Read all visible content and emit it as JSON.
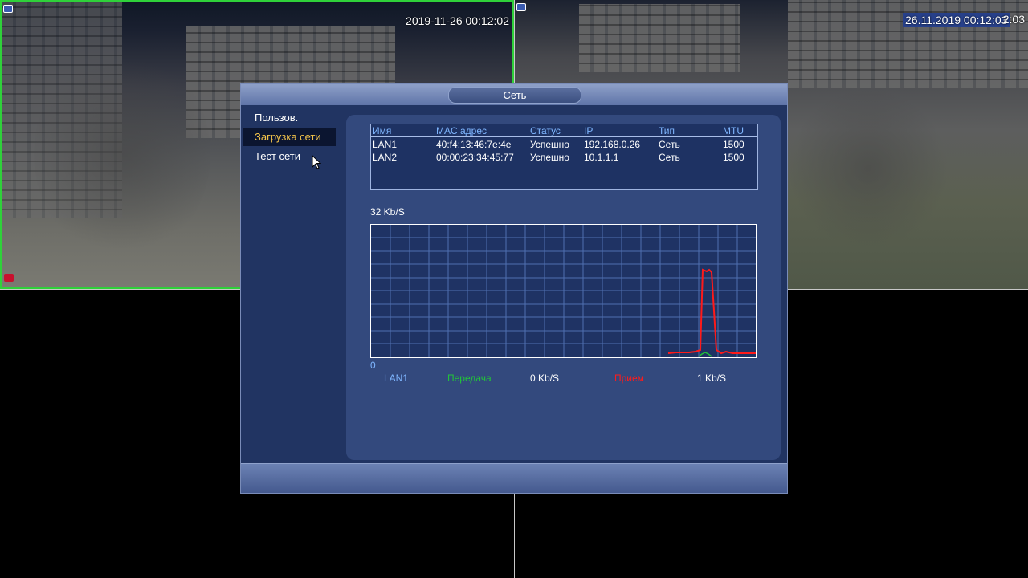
{
  "cameras": {
    "cam1": {
      "timestamp": "2019-11-26 00:12:02"
    },
    "cam2": {
      "timestamp": "26.11.2019 00:12:03",
      "timestamp_tail": "2:03"
    }
  },
  "dialog": {
    "title": "Сеть",
    "sidebar": [
      {
        "label": "Пользов.",
        "active": false
      },
      {
        "label": "Загрузка сети",
        "active": true
      },
      {
        "label": "Тест сети",
        "active": false
      }
    ],
    "table": {
      "headers": [
        "Имя",
        "MAC адрес",
        "Статус",
        "IP",
        "Тип",
        "MTU"
      ],
      "rows": [
        [
          "LAN1",
          "40:f4:13:46:7e:4e",
          "Успешно",
          "192.168.0.26",
          "Сеть",
          "1500"
        ],
        [
          "LAN2",
          "00:00:23:34:45:77",
          "Успешно",
          "10.1.1.1",
          "Сеть",
          "1500"
        ]
      ]
    },
    "graph": {
      "max_label": "32 Kb/S",
      "min_label": "0"
    },
    "legend": {
      "interface": "LAN1",
      "send_label": "Передача",
      "send_value": "0 Kb/S",
      "recv_label": "Прием",
      "recv_value": "1 Kb/S"
    }
  },
  "colors": {
    "send": "#22c23a",
    "recv": "#ff1a1a",
    "header_text": "#7fb6ff",
    "active_item": "#f2c34a"
  }
}
